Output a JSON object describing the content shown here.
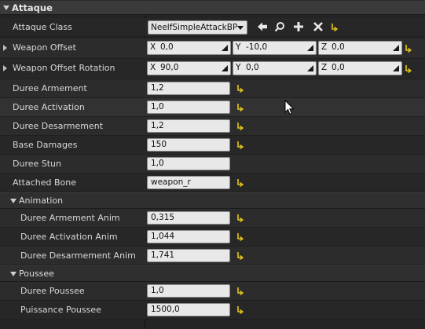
{
  "category": {
    "title": "Attaque"
  },
  "rows": {
    "attaque_class": {
      "label": "Attaque Class",
      "value": "NeelfSimpleAttackBP"
    },
    "weapon_offset": {
      "label": "Weapon Offset",
      "x_axis": "X",
      "x": "0,0",
      "y_axis": "Y",
      "y": "-10,0",
      "z_axis": "Z",
      "z": "0,0"
    },
    "weapon_offset_rotation": {
      "label": "Weapon Offset Rotation",
      "x_axis": "X",
      "x": "90,0",
      "y_axis": "Y",
      "y": "0,0",
      "z_axis": "Z",
      "z": "0,0"
    },
    "duree_armement": {
      "label": "Duree Armement",
      "value": "1,2"
    },
    "duree_activation": {
      "label": "Duree Activation",
      "value": "1,0"
    },
    "duree_desarmement": {
      "label": "Duree Desarmement",
      "value": "1,2"
    },
    "base_damages": {
      "label": "Base Damages",
      "value": "150"
    },
    "duree_stun": {
      "label": "Duree Stun",
      "value": "1,0"
    },
    "attached_bone": {
      "label": "Attached Bone",
      "value": "weapon_r"
    }
  },
  "animation": {
    "title": "Animation",
    "duree_armement_anim": {
      "label": "Duree Armement Anim",
      "value": "0,315"
    },
    "duree_activation_anim": {
      "label": "Duree Activation Anim",
      "value": "1,044"
    },
    "duree_desarmement_anim": {
      "label": "Duree Desarmement Anim",
      "value": "1,741"
    }
  },
  "poussee": {
    "title": "Poussee",
    "duree_poussee": {
      "label": "Duree Poussee",
      "value": "1,0"
    },
    "puissance_poussee": {
      "label": "Puissance Poussee",
      "value": "1500,0"
    }
  },
  "icons": {
    "use_selected": "arrow-left-icon",
    "browse": "search-icon",
    "new": "plus-icon",
    "clear": "close-icon",
    "reset": "reset-to-default-icon"
  },
  "colors": {
    "reset_arrow": "#e6c619",
    "panel_bg": "#242424",
    "header_bg": "#3a3a3a"
  }
}
